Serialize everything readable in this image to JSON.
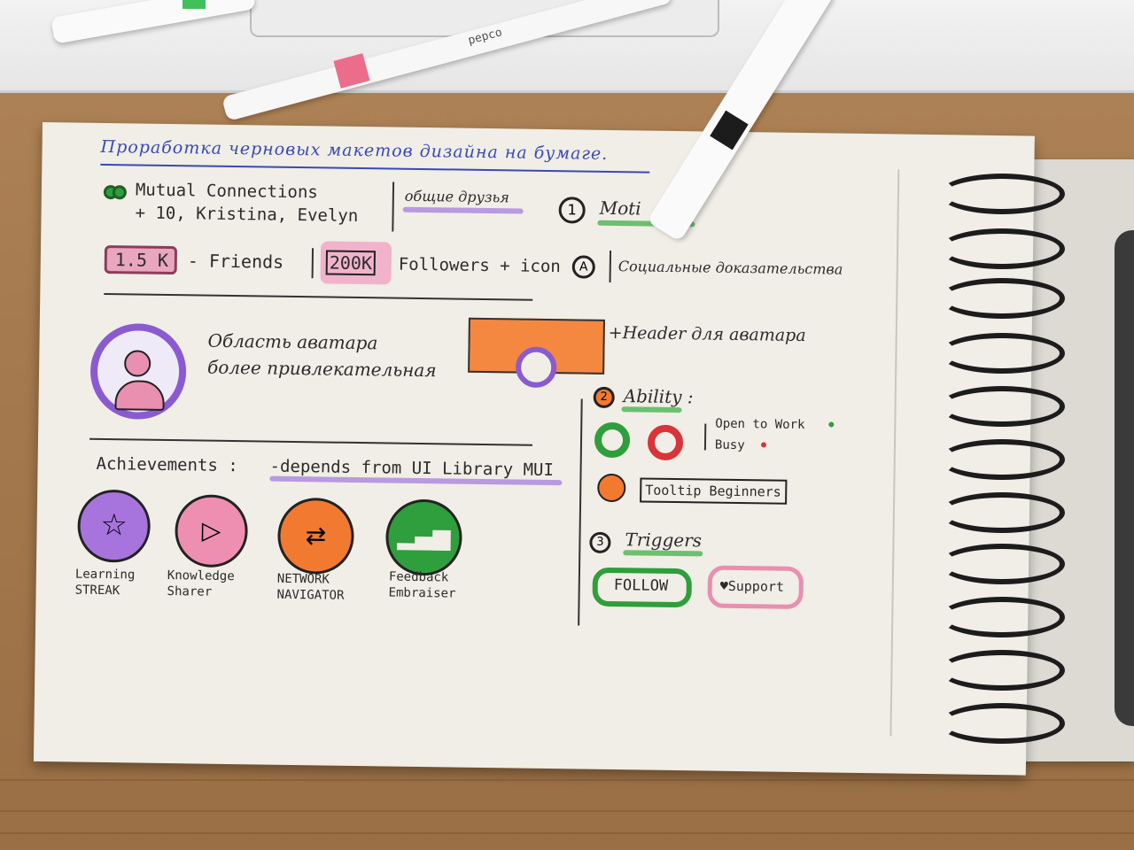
{
  "title": "Проработка черновых макетов дизайна на бумаге.",
  "mutual": {
    "line1": "Mutual Connections",
    "line2": "+ 10, Kristina, Evelyn",
    "tag": "общие друзья"
  },
  "motivation": {
    "num": "1",
    "label": "Moti"
  },
  "stats": {
    "friends_count": "1.5 K",
    "friends_label": "- Friends",
    "followers_count": "200K",
    "followers_label": "Followers + icon"
  },
  "social": {
    "num": "A",
    "label": "Социальные доказательства"
  },
  "avatar": {
    "line1": "Область аватара",
    "line2": "более привлекательная",
    "header_note": "+Header для аватара"
  },
  "ability": {
    "num": "2",
    "label": "Ability :",
    "open": "Open to Work",
    "busy": "Busy",
    "tooltip": "Tooltip Beginners"
  },
  "achievements": {
    "label": "Achievements :",
    "note": "-depends from UI Library MUI",
    "items": [
      {
        "line1": "Learning",
        "line2": "STREAK"
      },
      {
        "line1": "Knowledge",
        "line2": "Sharer"
      },
      {
        "line1": "NETWORK",
        "line2": "NAVIGATOR"
      },
      {
        "line1": "Feedback",
        "line2": "Embraiser"
      }
    ]
  },
  "triggers": {
    "num": "3",
    "label": "Triggers",
    "follow": "FOLLOW",
    "support": "♥Support"
  },
  "colors": {
    "purple": "#8a5bd0",
    "pink": "#e47a9e",
    "orange": "#f27a30",
    "green": "#2f9e3c",
    "red": "#d8343a"
  },
  "marker_text": "pepco"
}
